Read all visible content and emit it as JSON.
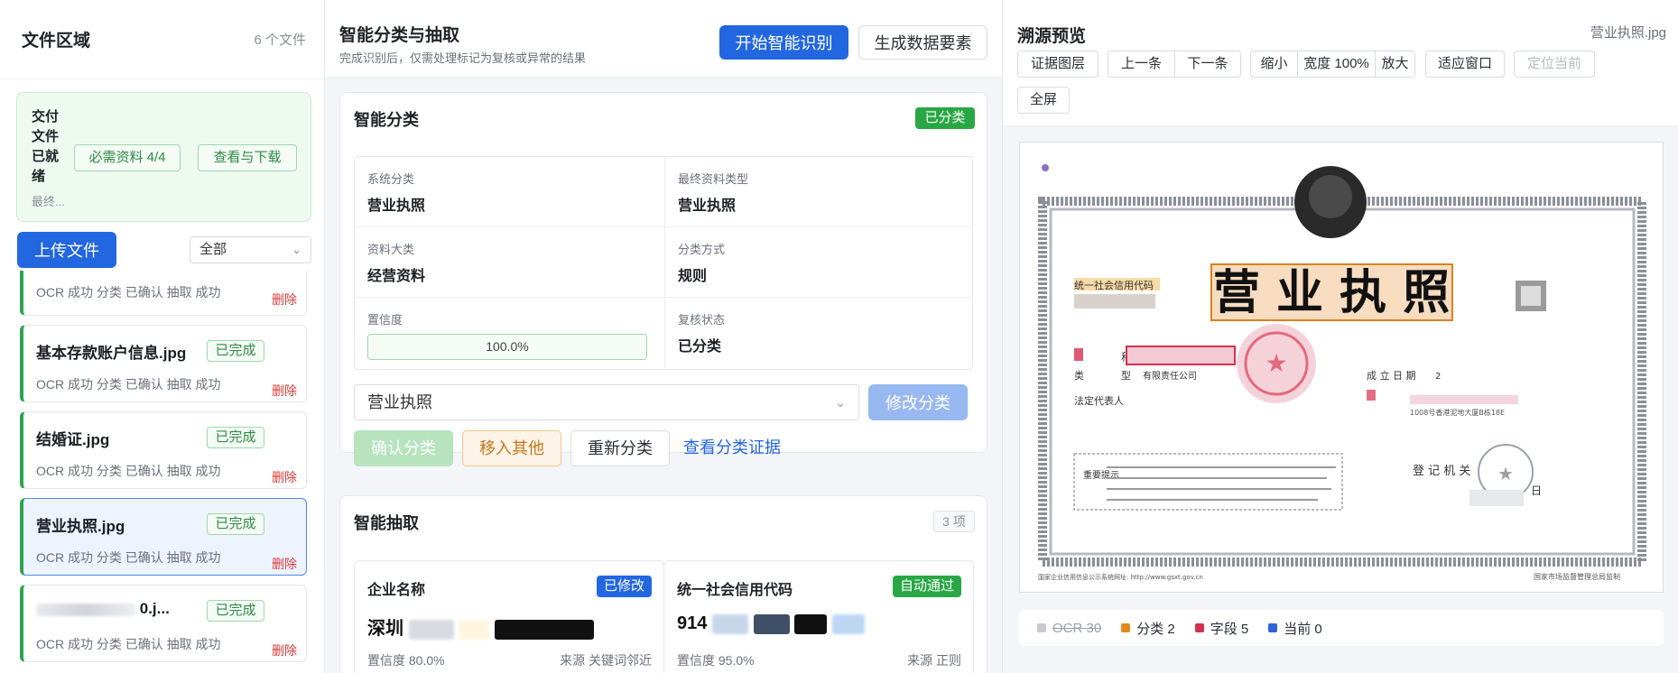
{
  "left": {
    "title": "文件区域",
    "file_count": "6 个文件",
    "ready": {
      "text": "交付文件已就绪",
      "required": "必需资料 4/4",
      "view_download": "查看与下载",
      "sub": "最终..."
    },
    "upload": "上传文件",
    "filter": "全部",
    "files": [
      {
        "name": "",
        "status": "",
        "meta": "OCR 成功   分类 已确认   抽取 成功",
        "delete": "删除"
      },
      {
        "name": "基本存款账户信息.jpg",
        "status": "已完成",
        "meta": "OCR 成功   分类 已确认   抽取 成功",
        "delete": "删除"
      },
      {
        "name": "结婚证.jpg",
        "status": "已完成",
        "meta": "OCR 成功   分类 已确认   抽取 成功",
        "delete": "删除"
      },
      {
        "name": "营业执照.jpg",
        "status": "已完成",
        "meta": "OCR 成功   分类 已确认   抽取 成功",
        "delete": "删除"
      },
      {
        "name": "0.j...",
        "status": "已完成",
        "meta": "OCR 成功   分类 已确认   抽取 成功",
        "delete": "删除"
      }
    ]
  },
  "mid": {
    "title": "智能分类与抽取",
    "subtitle": "完成识别后，仅需处理标记为复核或异常的结果",
    "start": "开始智能识别",
    "generate": "生成数据要素",
    "classify": {
      "title": "智能分类",
      "badge": "已分类",
      "cells": [
        {
          "label": "系统分类",
          "value": "营业执照"
        },
        {
          "label": "最终资料类型",
          "value": "营业执照"
        },
        {
          "label": "资料大类",
          "value": "经营资料"
        },
        {
          "label": "分类方式",
          "value": "规则"
        },
        {
          "label": "置信度",
          "value": "100.0%"
        },
        {
          "label": "复核状态",
          "value": "已分类"
        }
      ],
      "confidence": 1.0,
      "select_value": "营业执照",
      "modify": "修改分类",
      "confirm": "确认分类",
      "move_other": "移入其他",
      "reclassify": "重新分类",
      "view_evidence": "查看分类证据"
    },
    "extract": {
      "title": "智能抽取",
      "count": "3 项",
      "items": [
        {
          "label": "企业名称",
          "badge": "已修改",
          "badge_color": "#2266e0",
          "value": "深圳",
          "confidence": "置信度 80.0%",
          "source": "来源 关键词邻近"
        },
        {
          "label": "统一社会信用代码",
          "badge": "自动通过",
          "badge_color": "#29a745",
          "value": "914",
          "confidence": "置信度 95.0%",
          "source": "来源 正则"
        }
      ]
    }
  },
  "right": {
    "title": "溯源预览",
    "file": "营业执照.jpg",
    "toolbar": {
      "layers": "证据图层",
      "prev": "上一条",
      "next": "下一条",
      "zoom_out": "缩小",
      "width": "宽度 100%",
      "zoom_in": "放大",
      "fit": "适应窗口",
      "locate": "定位当前",
      "fullscreen": "全屏"
    },
    "doc": {
      "heading": "营 业 执 照",
      "credit_label": "统一社会信用代码",
      "name_label": "称",
      "type_label": "类",
      "type_label2": "型",
      "type_value": "有限责任公司",
      "legal_rep": "法定代表人",
      "founded": "成 立 日 期",
      "founded_value": "2",
      "address_hint": "1008号香港泥地大厦B栋18E",
      "notice": "重要提示",
      "authority": "登 记 机 关",
      "day": "日",
      "footer_left": "国家企业信用信息公示系统网址: http://www.gsxt.gov.cn",
      "footer_right": "国家市场监督管理总局监制"
    },
    "legend": [
      {
        "label": "OCR 30",
        "color": "#c7cbd1",
        "struck": true
      },
      {
        "label": "分类 2",
        "color": "#e08a1e",
        "struck": false
      },
      {
        "label": "字段 5",
        "color": "#d6304f",
        "struck": false
      },
      {
        "label": "当前 0",
        "color": "#2d63d8",
        "struck": false
      }
    ]
  }
}
